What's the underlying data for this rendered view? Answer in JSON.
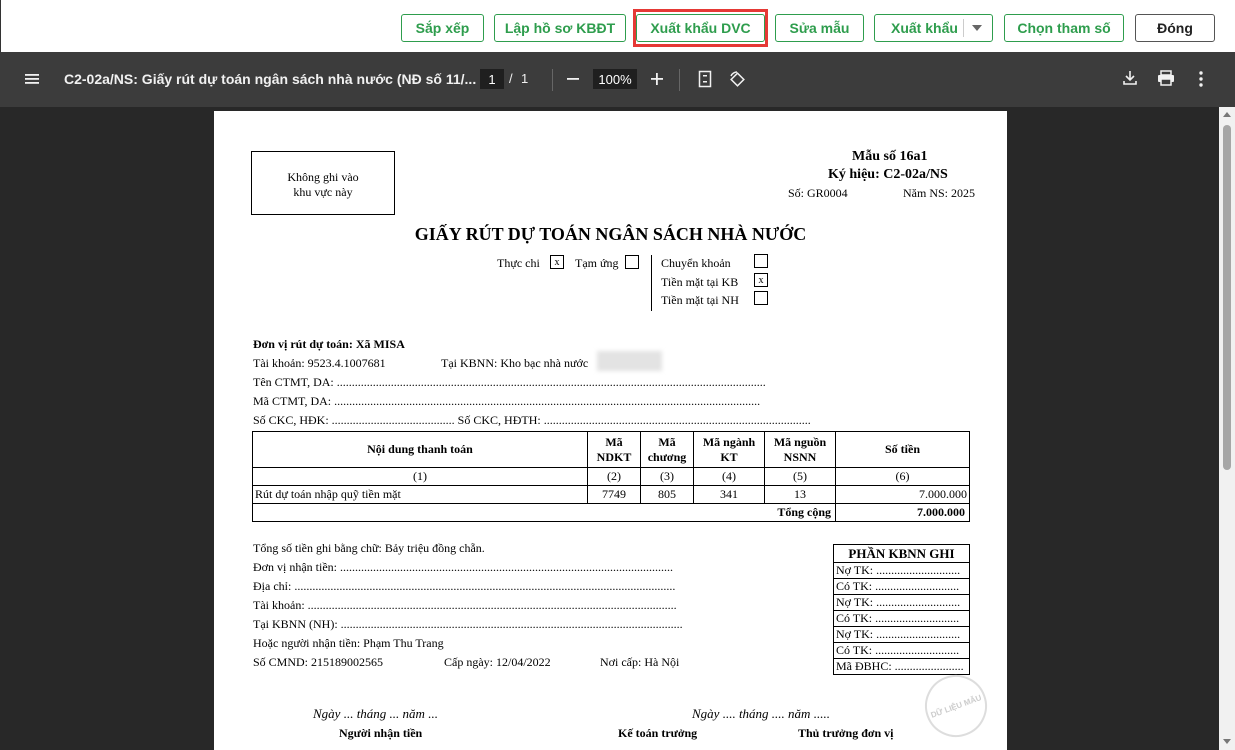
{
  "toolbar": {
    "buttons": [
      "Sắp xếp",
      "Lập hồ sơ KBĐT",
      "Xuất khẩu DVC",
      "Sửa mẫu",
      "Xuất khẩu",
      "Chọn tham số",
      "Đóng"
    ],
    "highlight_color": "#e53935",
    "accent_color": "#2e9d4d"
  },
  "viewer": {
    "title": "C2-02a/NS: Giấy rút dự toán ngân sách nhà nước (NĐ số 11/...",
    "page_current": "1",
    "page_sep": "/",
    "page_total": "1",
    "zoom": "100%",
    "icons": [
      "menu-icon",
      "zoom-out-icon",
      "zoom-in-icon",
      "fit-page-icon",
      "rotate-icon",
      "download-icon",
      "print-icon",
      "more-icon"
    ]
  },
  "doc": {
    "no_write_line1": "Không ghi vào",
    "no_write_line2": "khu vực này",
    "form_no": "Mẫu số 16a1",
    "symbol": "Ký hiệu: C2-02a/NS",
    "so": "Số: GR0004",
    "nam_ns": "Năm NS: 2025",
    "title": "GIẤY RÚT DỰ TOÁN NGÂN SÁCH NHÀ NƯỚC",
    "thuc_chi": "Thực chi",
    "thuc_chi_mark": "x",
    "tam_ung": "Tạm ứng",
    "chuyen_khoan": "Chuyển khoản",
    "tien_mat_kb": "Tiền mặt tại KB",
    "tien_mat_kb_mark": "x",
    "tien_mat_nh": "Tiền mặt tại NH",
    "don_vi": "Đơn vị rút dự toán: Xã MISA",
    "tai_khoan": "Tài khoản: 9523.4.1007681",
    "tai_kbnn": "Tại KBNN: Kho bạc nhà nước",
    "ten_ctmt": "Tên CTMT, DA: ...............................................................................................................................................",
    "ma_ctmt": "Mã CTMT, DA: ..............................................................................................................................................",
    "so_ckc_hdk": "Số CKC, HĐK: ......................................... Số CKC, HĐTH: .........................................................................................",
    "table_headers": [
      "Nội dung thanh toán",
      "Mã NDKT",
      "Mã chương",
      "Mã ngành KT",
      "Mã nguồn NSNN",
      "Số tiền"
    ],
    "table_indices": [
      "(1)",
      "(2)",
      "(3)",
      "(4)",
      "(5)",
      "(6)"
    ],
    "table_rows": [
      [
        "Rút dự toán nhập quỹ tiền mặt",
        "7749",
        "805",
        "341",
        "13",
        "7.000.000"
      ]
    ],
    "total_label": "Tổng cộng",
    "total_value": "7.000.000",
    "amount_words": "Tổng số tiền ghi bằng chữ: Bảy triệu đồng chẵn.",
    "don_vi_nhan": "Đơn vị nhận tiền: ...............................................................................................................",
    "dia_chi": "Địa chỉ: ...............................................................................................................................",
    "tai_khoan2": "Tài khoản: ...........................................................................................................................",
    "tai_kbnn2": "Tại KBNN (NH): ..................................................................................................................",
    "nguoi_nhan": "Hoặc người nhận tiền: Phạm Thu Trang",
    "so_cmnd": "Số CMND: 215189002565",
    "cap_ngay": "Cấp ngày: 12/04/2022",
    "noi_cap": "Nơi cấp: Hà Nội",
    "side_title": "PHẦN KBNN GHI",
    "side_rows": [
      "Nợ TK: ............................",
      "Có TK: ............................",
      "Nợ TK: ............................",
      "Có TK: ............................",
      "Nợ TK: ............................",
      "Có TK: ............................",
      "Mã ĐBHC: ......................."
    ],
    "date_left": "Ngày ... tháng ... năm ...",
    "date_right": "Ngày .... tháng .... năm .....",
    "sign_receiver": "Người nhận tiền",
    "sign_accountant": "Kế toán trưởng",
    "sign_head": "Thủ trưởng đơn vị",
    "stamp": "DỮ LIỆU MẪU"
  }
}
